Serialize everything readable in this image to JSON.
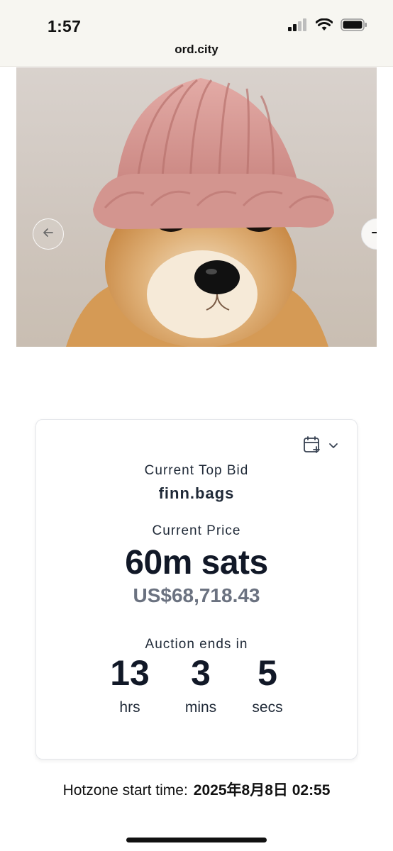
{
  "status_bar": {
    "time": "1:57",
    "url": "ord.city",
    "icons": [
      "cellular-signal-icon",
      "wifi-icon",
      "battery-icon"
    ]
  },
  "hero": {
    "image": "dog-with-pink-knit-hat-image",
    "prev_icon": "arrow-left-icon",
    "next_icon": "arrow-right-icon"
  },
  "auction": {
    "calendar_icon": "calendar-add-icon",
    "top_bid_label": "Current Top Bid",
    "top_bidder": "finn.bags",
    "price_label": "Current Price",
    "price": "60m sats",
    "price_usd": "US$68,718.43",
    "ends_label": "Auction ends in",
    "countdown": [
      {
        "value": "13",
        "unit": "hrs"
      },
      {
        "value": "3",
        "unit": "mins"
      },
      {
        "value": "5",
        "unit": "secs"
      }
    ]
  },
  "hotzone": {
    "label": "Hotzone start time:",
    "value": "2025年8月8日 02:55"
  },
  "colors": {
    "text_primary": "#111827",
    "text_muted": "#6b7280",
    "hat": "#d89a96",
    "fur": "#d9a365"
  }
}
